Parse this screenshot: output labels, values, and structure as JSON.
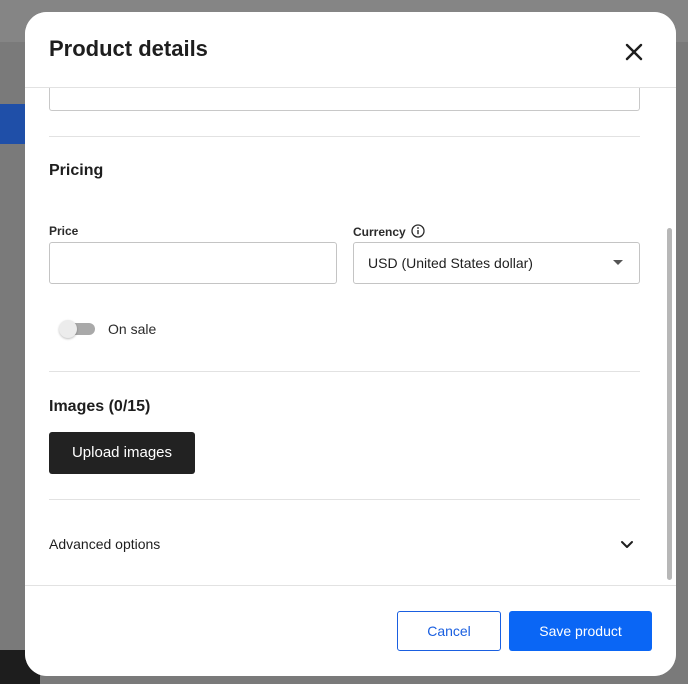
{
  "modal": {
    "title": "Product details"
  },
  "pricing": {
    "section_title": "Pricing",
    "price_label": "Price",
    "price_value": "",
    "currency_label": "Currency",
    "currency_value": "USD (United States dollar)",
    "on_sale_label": "On sale",
    "on_sale_checked": false
  },
  "images": {
    "section_title": "Images (0/15)",
    "upload_label": "Upload images"
  },
  "advanced": {
    "label": "Advanced options"
  },
  "footer": {
    "cancel_label": "Cancel",
    "save_label": "Save product"
  },
  "colors": {
    "primary": "#0a66f5",
    "upload_button": "#222222"
  },
  "icons": {
    "close": "close-icon",
    "info": "info-icon",
    "caret": "caret-down-icon",
    "chevron": "chevron-down-icon"
  }
}
